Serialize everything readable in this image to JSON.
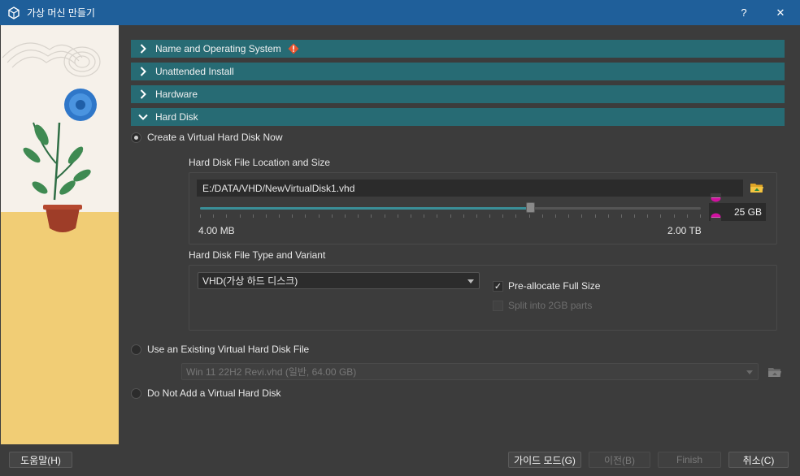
{
  "window": {
    "title": "가상 머신 만들기",
    "help_label": "?",
    "close_label": "✕"
  },
  "sections": [
    {
      "label": "Name and Operating System",
      "expanded": false,
      "has_warning": true
    },
    {
      "label": "Unattended Install",
      "expanded": false
    },
    {
      "label": "Hardware",
      "expanded": false
    },
    {
      "label": "Hard Disk",
      "expanded": true
    }
  ],
  "hard_disk": {
    "option_create": "Create a Virtual Hard Disk Now",
    "location_group_label": "Hard Disk File Location and Size",
    "file_path": "E:/DATA/VHD/NewVirtualDisk1.vhd",
    "size_slider": {
      "min_label": "4.00 MB",
      "max_label": "2.00 TB",
      "position_fraction": 0.66
    },
    "size_value": "25 GB",
    "type_group_label": "Hard Disk File Type and Variant",
    "type_selected": "VHD(가상 하드 디스크)",
    "preallocate_label": "Pre-allocate Full Size",
    "preallocate_checked": true,
    "split_label": "Split into 2GB parts",
    "split_enabled": false,
    "option_existing": "Use an Existing Virtual Hard Disk File",
    "existing_selected": "Win 11 22H2 Revi.vhd (일반, 64.00 GB)",
    "option_none": "Do Not Add a Virtual Hard Disk"
  },
  "buttons": {
    "help": "도움말(H)",
    "guided": "가이드 모드(G)",
    "back": "이전(B)",
    "finish": "Finish",
    "cancel": "취소(C)"
  },
  "colors": {
    "titlebar": "#1f5f9a",
    "section_header": "#276b74",
    "background": "#3c3c3c",
    "slider_accent": "#3a8f98",
    "size_marker": "#d0119f",
    "warning": "#e8542f"
  },
  "icons": {
    "app": "virtualbox-icon",
    "collapsed_chevron": "chevron-right-icon",
    "expanded_chevron": "chevron-down-icon",
    "warning": "warning-icon",
    "folder": "folder-open-icon"
  }
}
